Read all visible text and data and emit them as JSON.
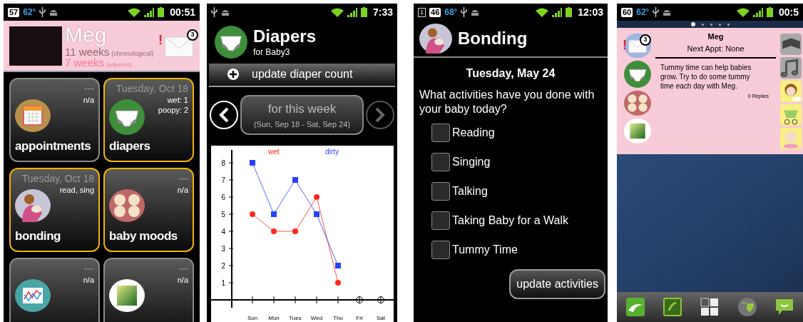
{
  "dashboard": {
    "status_bar": {
      "left": [
        {
          "text": "57",
          "kind": "badge"
        },
        {
          "text": "62°",
          "kind": "temp"
        }
      ],
      "time": "00:51"
    },
    "profile": {
      "name": "Meg",
      "age": "11 weeks",
      "age_note": "(chronological)",
      "adjusted_age": "7 weeks",
      "adjusted_note": "(adjusted)",
      "alert": "!",
      "message_count": "3"
    },
    "tiles": [
      {
        "date": "---",
        "summary": [
          "n/a"
        ],
        "label": "appointments",
        "highlighted": false
      },
      {
        "date": "Tuesday, Oct 18",
        "summary": [
          "wet: 1",
          "poopy: 2"
        ],
        "label": "diapers",
        "highlighted": true
      },
      {
        "date": "Tuesday, Oct 18",
        "summary": [
          "read, sing"
        ],
        "label": "bonding",
        "highlighted": true
      },
      {
        "date": "---",
        "summary": [
          "n/a"
        ],
        "label": "baby moods",
        "highlighted": true
      },
      {
        "date": "---",
        "summary": [
          "n/a"
        ],
        "highlighted": false
      },
      {
        "date": "---",
        "summary": [
          "n/a"
        ],
        "highlighted": false
      }
    ]
  },
  "diapers": {
    "status_bar": {
      "time": "7:33"
    },
    "title": "Diapers",
    "subtitle": "for Baby3",
    "update_button": "update diaper count",
    "week": {
      "title": "for this week",
      "range": "(Sun, Sep 18 - Sat, Sep 24)",
      "prev_disabled": false,
      "next_disabled": true
    },
    "chart_data": {
      "type": "line",
      "categories": [
        "Sun",
        "Mon",
        "Tues",
        "Wed",
        "Thu",
        "Fri",
        "Sat"
      ],
      "series": [
        {
          "name": "wet",
          "color": "#ff2a1a",
          "marker": "circle",
          "values": [
            5,
            4,
            4,
            6,
            1,
            null,
            null
          ]
        },
        {
          "name": "dirty",
          "color": "#2a40ff",
          "marker": "square",
          "values": [
            8,
            5,
            7,
            5,
            2,
            null,
            null
          ]
        }
      ],
      "ylim": [
        0,
        9
      ],
      "yticks": [
        1,
        2,
        3,
        4,
        5,
        6,
        7,
        8
      ]
    }
  },
  "bonding": {
    "status_bar": {
      "left": [
        {
          "text": "1",
          "kind": "box"
        },
        {
          "text": "46",
          "kind": "badge"
        },
        {
          "text": "68°",
          "kind": "temp"
        }
      ],
      "time": "12:03"
    },
    "title": "Bonding",
    "date": "Tuesday, May 24",
    "question": "What activities have you done with your baby today?",
    "activities": [
      {
        "label": "Reading",
        "checked": false
      },
      {
        "label": "Singing",
        "checked": false
      },
      {
        "label": "Talking",
        "checked": false
      },
      {
        "label": "Taking Baby for a Walk",
        "checked": false
      },
      {
        "label": "Tummy Time",
        "checked": false
      }
    ],
    "update_button": "update activities"
  },
  "launcher": {
    "status_bar": {
      "left": [
        {
          "text": "60",
          "kind": "badge"
        },
        {
          "text": "62°",
          "kind": "temp"
        }
      ],
      "time": "00:5"
    },
    "page_dots": [
      {
        "selected": true
      },
      {
        "selected": false
      },
      {
        "selected": false
      },
      {
        "selected": false
      },
      {
        "selected": false
      }
    ],
    "widget": {
      "message_count": "3",
      "alert": "!",
      "name": "Meg",
      "next_appt": "Next Appt: None",
      "tip": "Tummy time can help babies grow. Try to do some tummy time each day with Meg.",
      "replies": "0 Replies"
    }
  }
}
